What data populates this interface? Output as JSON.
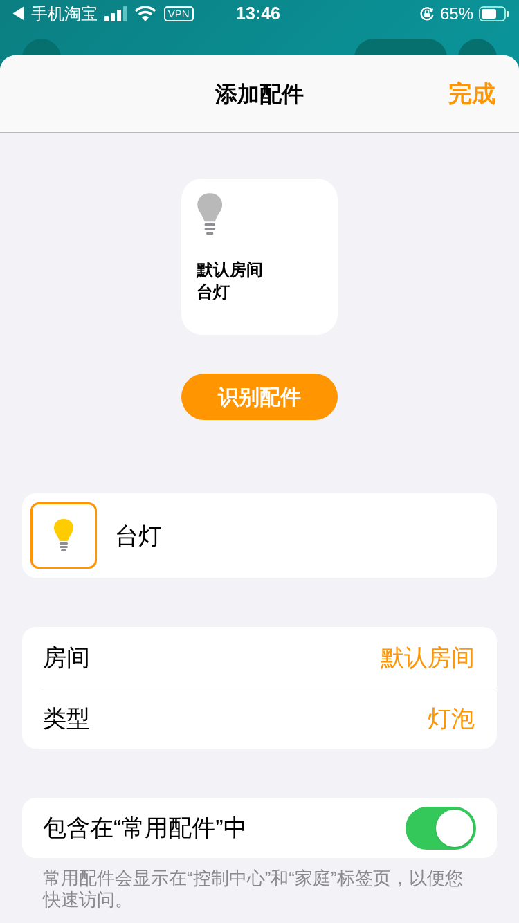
{
  "status_bar": {
    "back_app": "◀ 手机淘宝",
    "vpn": "VPN",
    "time": "13:46",
    "battery": "65%"
  },
  "nav": {
    "title": "添加配件",
    "done": "完成"
  },
  "tile": {
    "room": "默认房间",
    "name": "台灯"
  },
  "identify_button": "识别配件",
  "name_field": {
    "value": "台灯"
  },
  "details": [
    {
      "label": "房间",
      "value": "默认房间"
    },
    {
      "label": "类型",
      "value": "灯泡"
    }
  ],
  "favorite": {
    "label": "包含在“常用配件”中",
    "on": true
  },
  "footnote": "常用配件会显示在“控制中心”和“家庭”标签页，以便您快速访问。"
}
